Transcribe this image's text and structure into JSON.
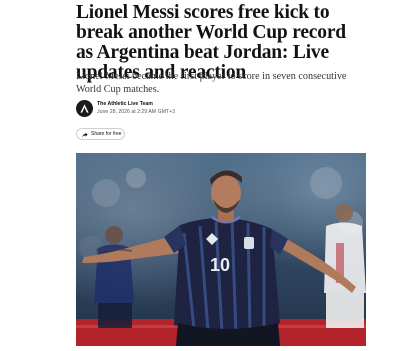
{
  "article": {
    "headline": "Lionel Messi scores free kick to break another World Cup record as Argentina beat Jordan: Live updates and reaction",
    "summary": "Lionel Messi became the first player to score in seven consecutive World Cup matches.",
    "byline": {
      "author": "The Athletic Live Team",
      "date": "June 28, 2026 at 2:29 AM GMT+3",
      "avatar_icon": "athletic-logo-icon"
    },
    "share": {
      "label": "Share for free",
      "icon": "share-arrow-icon"
    },
    "photo": {
      "jersey_number": "10",
      "colors": {
        "jersey": "#1d2340",
        "jersey_stripes": "#3c4f8a",
        "stadium": "#3a5572",
        "pitch_boards": "#b3232b",
        "opponent_kit": "#ffffff"
      }
    }
  }
}
